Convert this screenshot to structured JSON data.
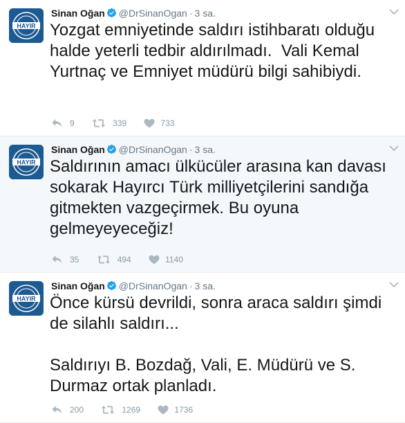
{
  "colors": {
    "verified": "#1da1f2",
    "avatar": "#1d5a91",
    "icon": "#aab8c2",
    "text": "#14171a",
    "muted": "#657786"
  },
  "tweets": [
    {
      "name": "Sinan Oğan",
      "handle": "@DrSinanOgan",
      "time": "3 sa.",
      "text": "Yozgat emniyetinde saldırı istihbaratı olduğu halde yeterli tedbir aldırılmadı.  Vali Kemal Yurtnaç ve Emniyet müdürü bilgi sahibiydi.",
      "replies": "9",
      "retweets": "339",
      "likes": "733"
    },
    {
      "name": "Sinan Oğan",
      "handle": "@DrSinanOgan",
      "time": "3 sa.",
      "text": "Saldırının amacı ülkücüler arasına kan davası sokarak Hayırcı Türk milliyetçilerini sandığa gitmekten vazgeçirmek. Bu oyuna gelmeyeyeceğiz!",
      "replies": "35",
      "retweets": "494",
      "likes": "1140"
    },
    {
      "name": "Sinan Oğan",
      "handle": "@DrSinanOgan",
      "time": "3 sa.",
      "text": "Önce kürsü devrildi, sonra araca saldırı şimdi de silahlı saldırı...\n\nSaldırıyı B. Bozdağ, Vali, E. Müdürü ve S. Durmaz ortak planladı.",
      "replies": "200",
      "retweets": "1269",
      "likes": "1736"
    }
  ],
  "avatar_label": "HAYIR",
  "icons": [
    "verified-icon",
    "reply-icon",
    "retweet-icon",
    "like-icon",
    "chevron-down-icon"
  ]
}
